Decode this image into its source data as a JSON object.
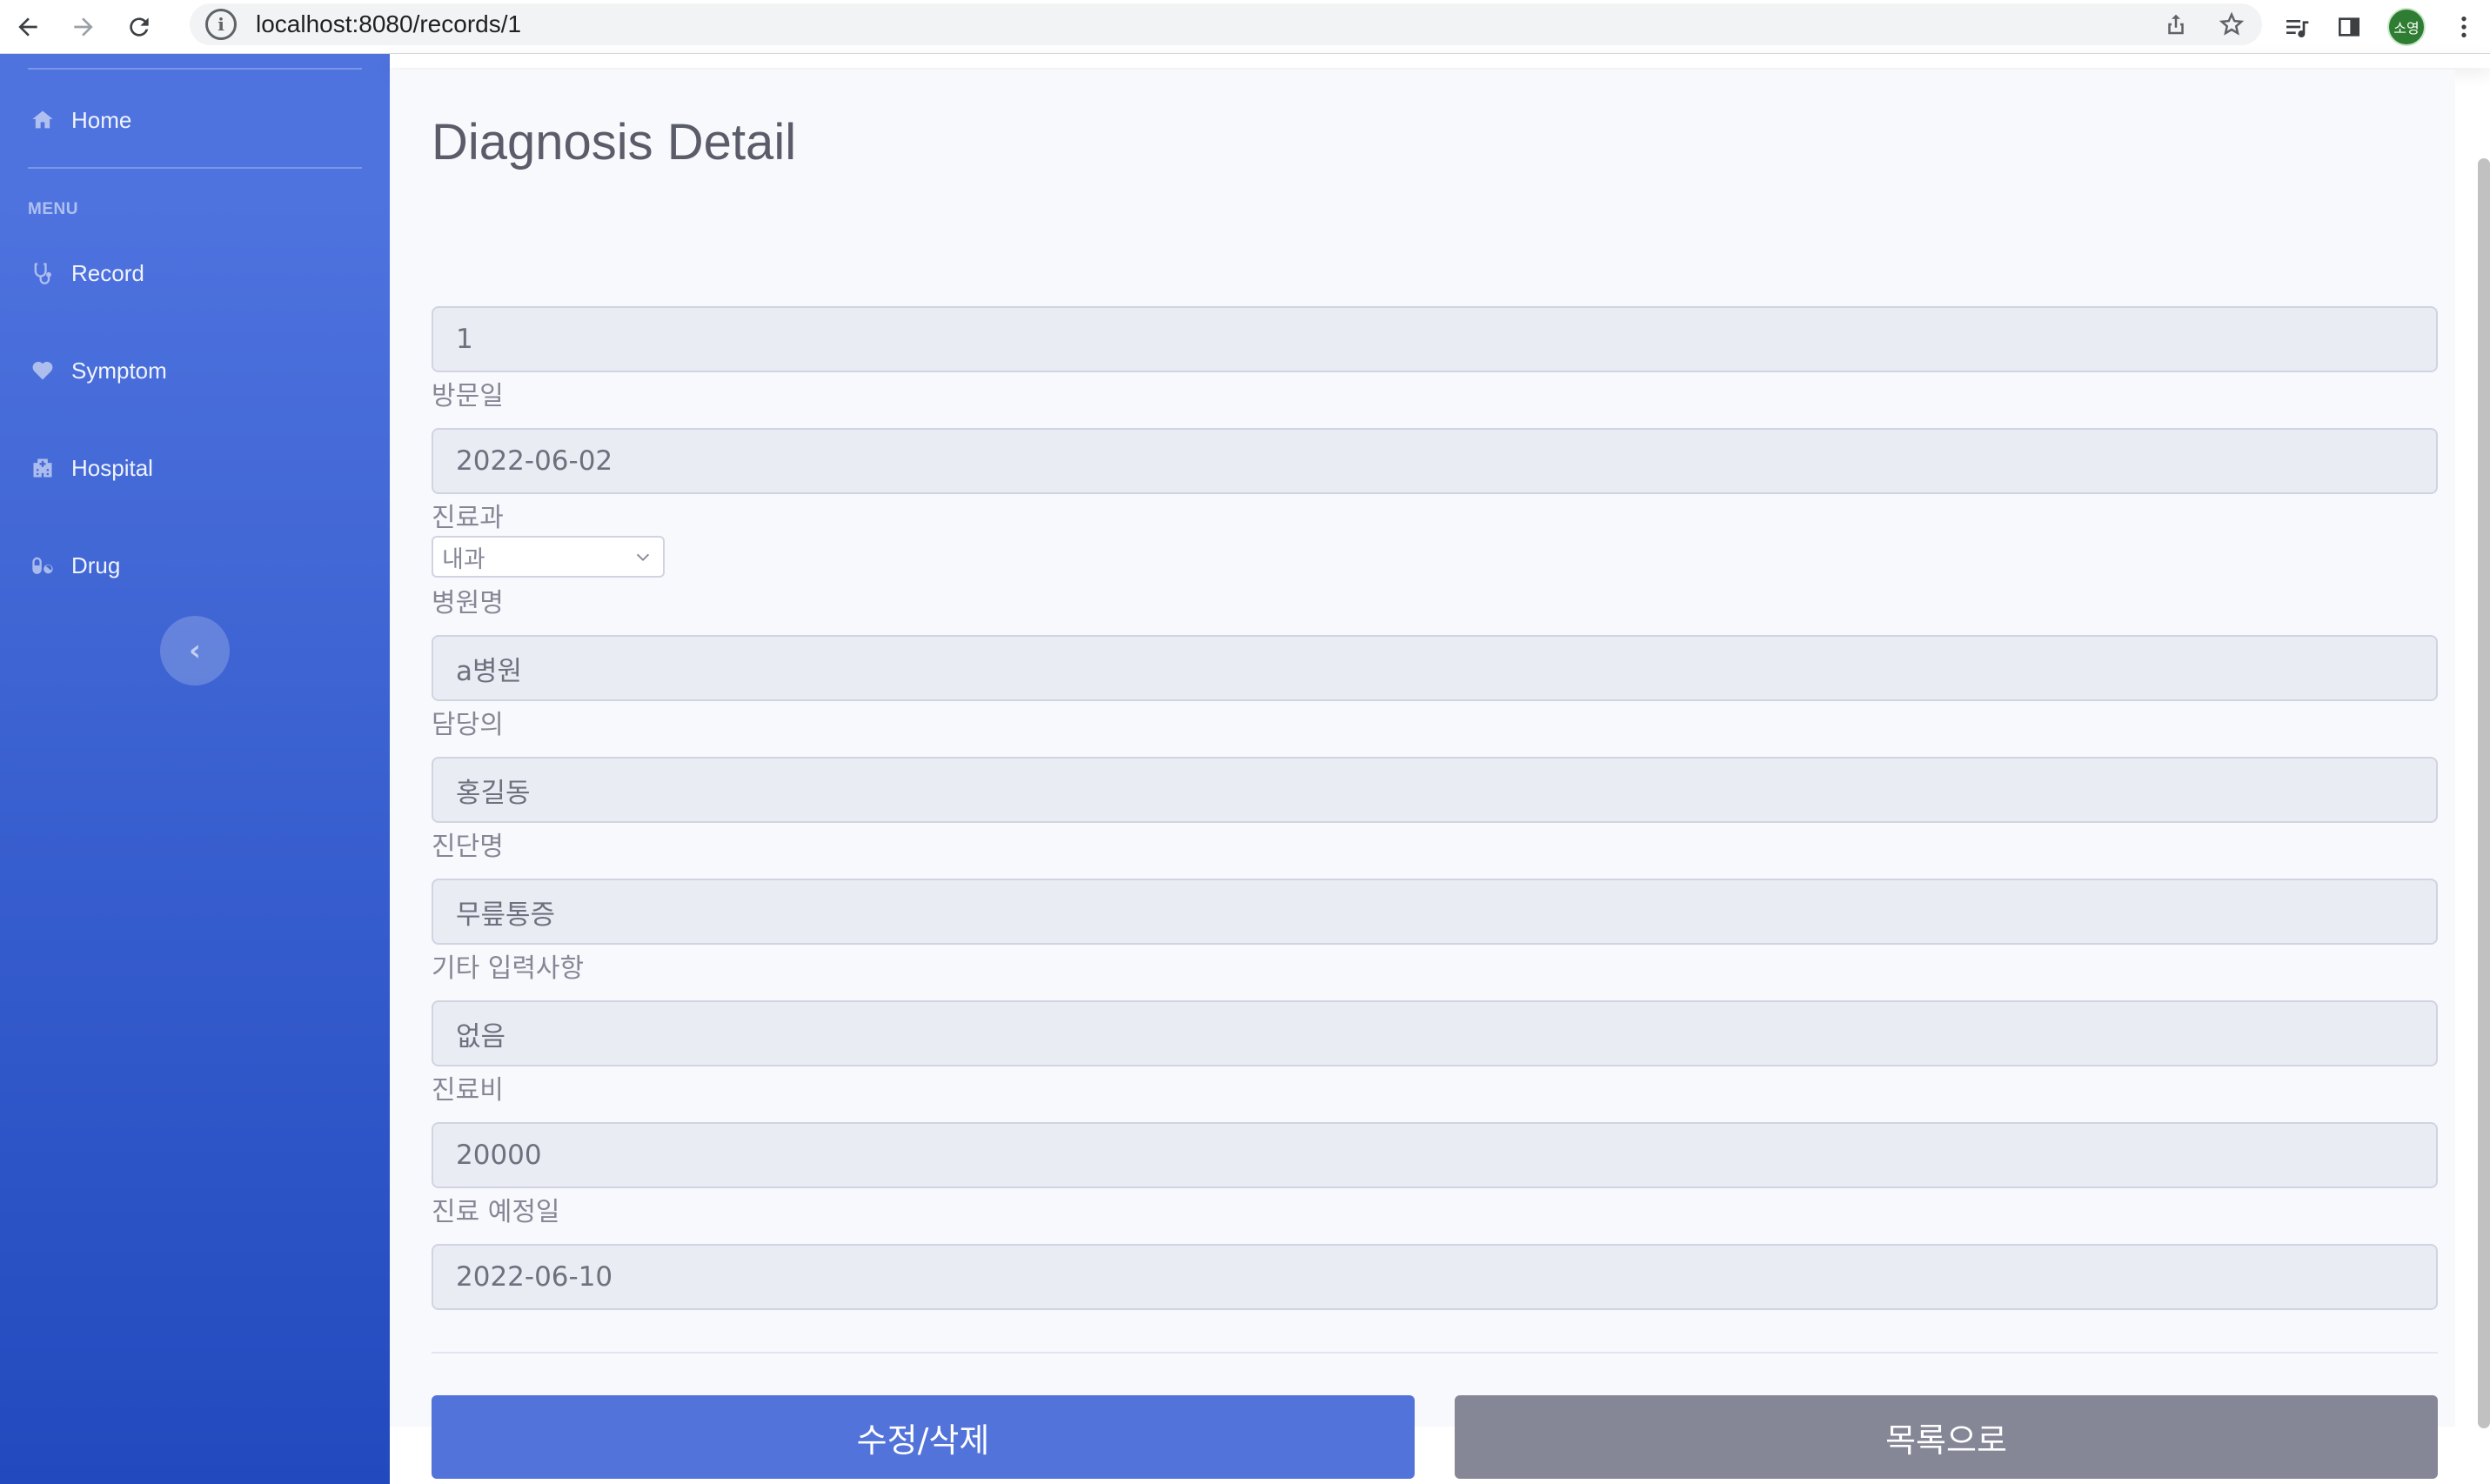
{
  "browser": {
    "url": "localhost:8080/records/1",
    "profile_initials": "소영"
  },
  "sidebar": {
    "home_label": "Home",
    "menu_heading": "MENU",
    "items": [
      {
        "label": "Record",
        "icon": "stethoscope-icon"
      },
      {
        "label": "Symptom",
        "icon": "heartbeat-icon"
      },
      {
        "label": "Hospital",
        "icon": "hospital-icon"
      },
      {
        "label": "Drug",
        "icon": "capsules-icon"
      }
    ],
    "toggle_glyph": "‹"
  },
  "page": {
    "title": "Diagnosis Detail"
  },
  "form": {
    "id_value": "1",
    "visit_date_label": "방문일",
    "visit_date_value": "2022-06-02",
    "department_label": "진료과",
    "department_value": "내과",
    "hospital_label": "병원명",
    "hospital_value": "a병원",
    "doctor_label": "담당의",
    "doctor_value": "홍길동",
    "diagnosis_label": "진단명",
    "diagnosis_value": "무릎통증",
    "notes_label": "기타 입력사항",
    "notes_value": "없음",
    "fee_label": "진료비",
    "fee_value": "20000",
    "next_visit_label": "진료 예정일",
    "next_visit_value": "2022-06-10"
  },
  "actions": {
    "edit_delete_label": "수정/삭제",
    "back_to_list_label": "목록으로"
  },
  "colors": {
    "sidebar_top": "#4e73df",
    "sidebar_bottom": "#224abe",
    "primary": "#5273d9",
    "secondary": "#858796"
  }
}
